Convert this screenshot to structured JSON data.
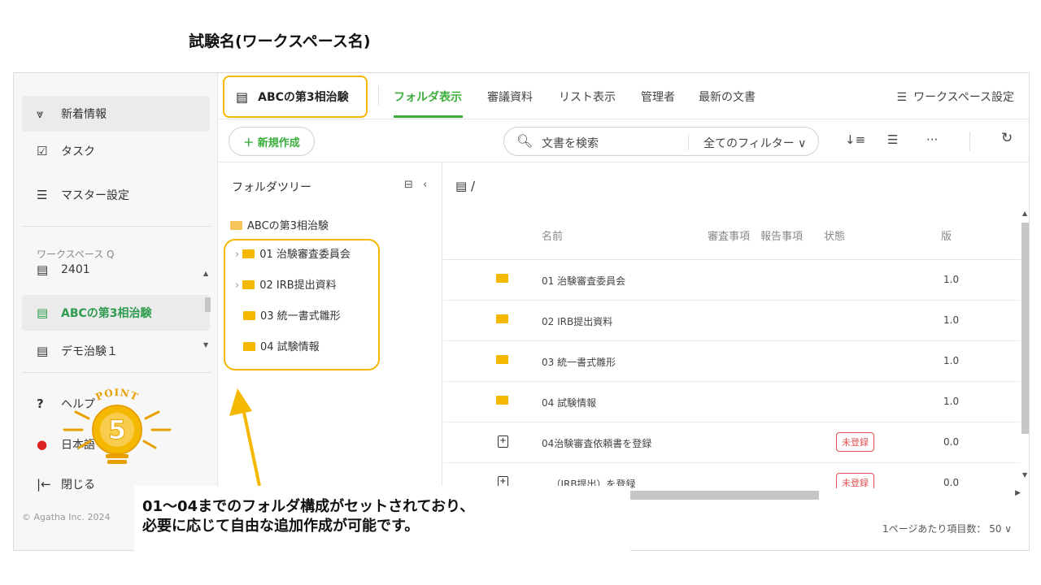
{
  "caption": "試験名(ワークスペース名)",
  "sidebar": {
    "news": "新着情報",
    "task": "タスク",
    "master": "マスター設定",
    "workspace_label": "ワークスペース Q",
    "ws_items": [
      "2401",
      "ABCの第3相治験",
      "デモ治験１"
    ],
    "help": "ヘルプ",
    "language": "日本語",
    "close": "閉じる",
    "copyright": "© Agatha Inc. 2024"
  },
  "point": {
    "label": "POINT",
    "number": "5"
  },
  "header": {
    "workspace": "ABCの第3相治験",
    "tabs": [
      "フォルダ表示",
      "審議資料",
      "リスト表示",
      "管理者",
      "最新の文書"
    ],
    "settings": "ワークスペース設定"
  },
  "toolbar": {
    "new": "＋  新規作成",
    "search_placeholder": "文書を検索",
    "filter": "全てのフィルター ∨"
  },
  "tree": {
    "title": "フォルダツリー",
    "root": "ABCの第3相治験",
    "nodes": [
      "01 治験審査委員会",
      "02 IRB提出資料",
      "03 統一書式雛形",
      "04 試験情報"
    ]
  },
  "list": {
    "path": "/",
    "headers": {
      "name": "名前",
      "deliberation": "審査事項",
      "report": "報告事項",
      "status": "状態",
      "version": "版"
    },
    "rows": [
      {
        "name": "01 治験審査委員会",
        "version": "1.0",
        "type": "folder"
      },
      {
        "name": "02 IRB提出資料",
        "version": "1.0",
        "type": "folder"
      },
      {
        "name": "03 統一書式雛形",
        "version": "1.0",
        "type": "folder"
      },
      {
        "name": "04 試験情報",
        "version": "1.0",
        "type": "folder"
      },
      {
        "name": "04治験審査依頼書を登録",
        "version": "0.0",
        "type": "doc",
        "status": "未登録"
      },
      {
        "name": "...（IRB提出）を登録",
        "version": "0.0",
        "type": "doc",
        "status": "未登録"
      }
    ],
    "per_page": "1ページあたり項目数：  50 ∨"
  },
  "annotation": {
    "line1": "01〜04までのフォルダ構成がセットされており、",
    "line2": "必要に応じて自由な追加作成が可能です。"
  },
  "colors": {
    "accent": "#3cae3c",
    "highlight": "#f5b800",
    "badge": "#e05050"
  }
}
